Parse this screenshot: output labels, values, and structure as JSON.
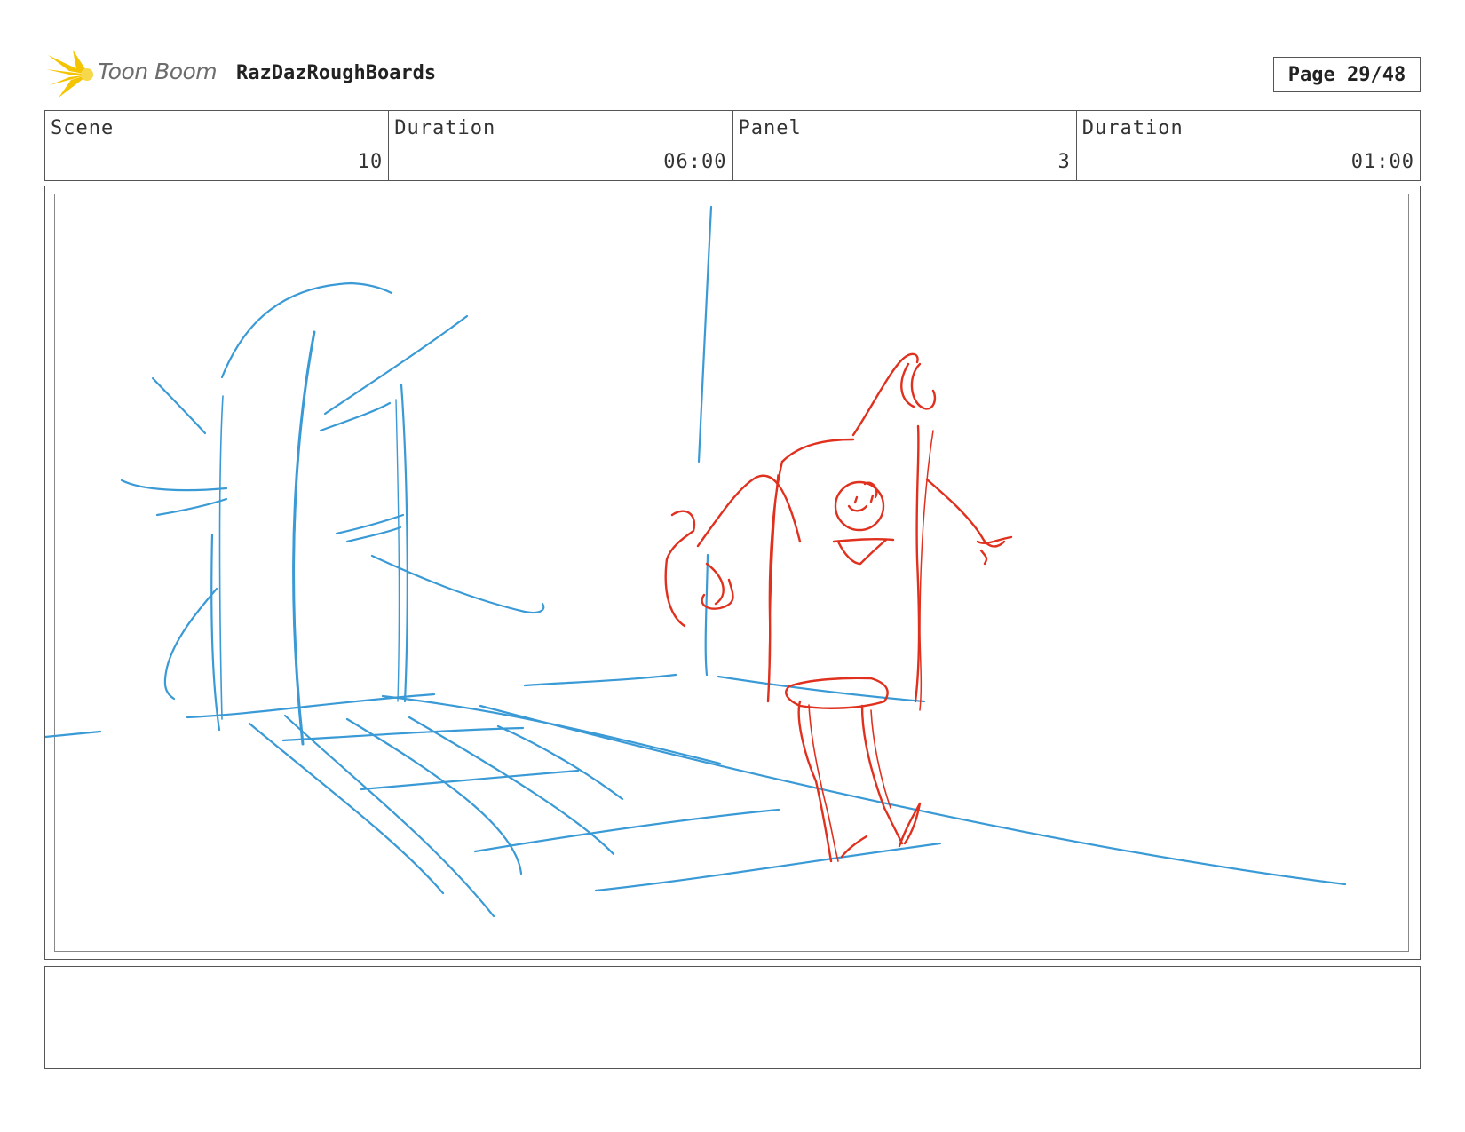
{
  "header": {
    "logo_text": "Toon Boom",
    "project_title": "RazDazRoughBoards",
    "page_label": "Page 29/48"
  },
  "info": [
    {
      "label": "Scene",
      "value": "10"
    },
    {
      "label": "Duration",
      "value": "06:00"
    },
    {
      "label": "Panel",
      "value": "3"
    },
    {
      "label": "Duration",
      "value": "01:00"
    }
  ],
  "colors": {
    "background_sketch": "#3a9ad6",
    "character_sketch": "#e0301e",
    "logo_burst": "#f5c400"
  },
  "notes": ""
}
